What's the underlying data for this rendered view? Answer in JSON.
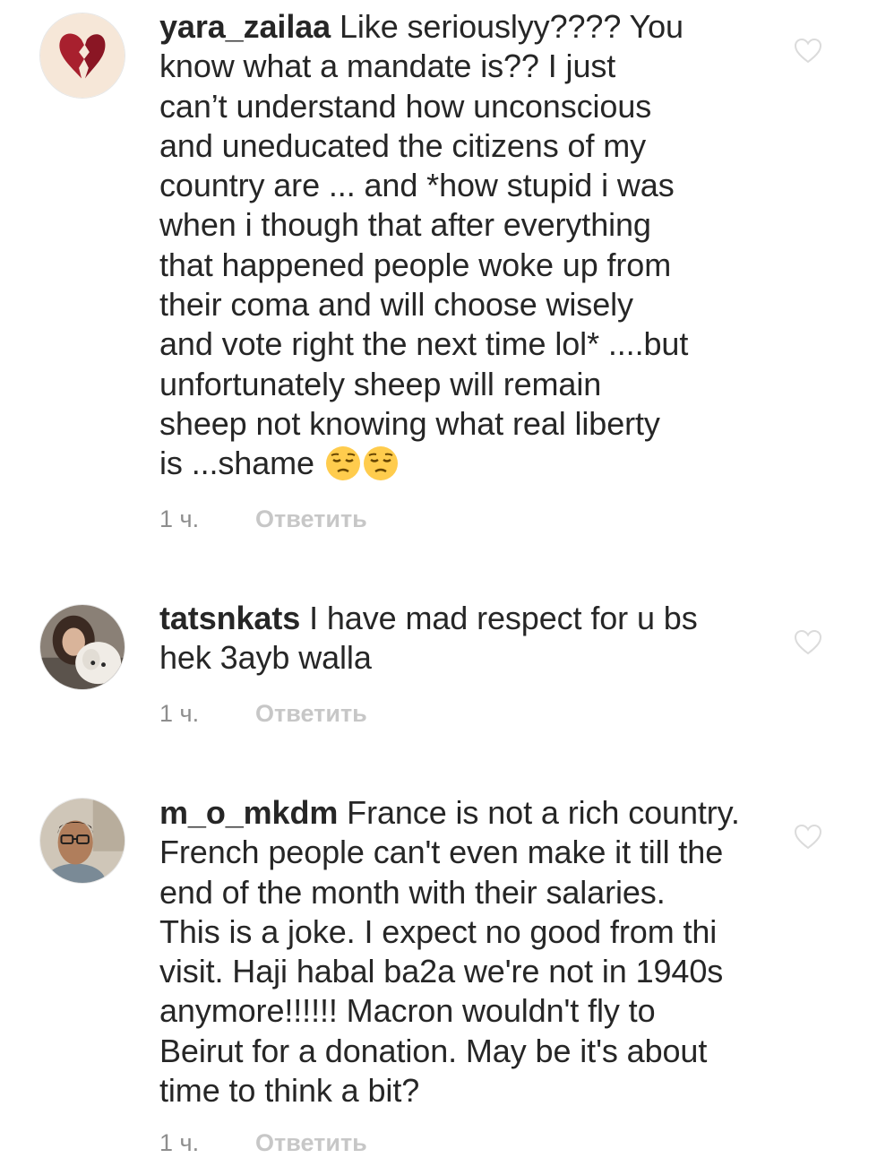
{
  "comments": [
    {
      "username": "yara_zailaa",
      "text": " Like seriouslyy???? You\nknow what a mandate is?? I just\ncan’t understand how  unconscious\nand uneducated the citizens of my\ncountry are ... and *how stupid i was\nwhen i though that after everything\nthat happened people woke up from\ntheir coma and will choose wisely\nand vote right the next time lol* ....but\nunfortunately sheep will remain\nsheep not knowing what real liberty\nis ...shame ",
      "emoji": [
        "pensive-face-emoji",
        "pensive-face-emoji"
      ],
      "time": "1 ч.",
      "reply_label": "Ответить",
      "avatar_icon": "broken-heart-avatar"
    },
    {
      "username": "tatsnkats",
      "text": " I have mad respect for u bs\nhek 3ayb walla",
      "time": "1 ч.",
      "reply_label": "Ответить",
      "avatar_icon": "woman-with-dog-photo-avatar"
    },
    {
      "username": "m_o_mkdm",
      "text": " France is not a rich country.\nFrench people can't even make it till the\nend of the month with their salaries.\nThis is a joke. I expect no good from thi\nvisit. Haji habal ba2a we're not in 1940s\nanymore!!!!!! Macron wouldn't fly to\nBeirut for a donation. May be it's about\ntime to think a bit?",
      "time": "1 ч.",
      "reply_label": "Ответить",
      "avatar_icon": "man-with-glasses-photo-avatar"
    }
  ],
  "colors": {
    "text": "#262626",
    "meta": "#8e8e8e",
    "reply": "#c7c7c7",
    "heart_outline": "#dbdbdb"
  },
  "icons": {
    "like": "heart-outline-icon"
  }
}
